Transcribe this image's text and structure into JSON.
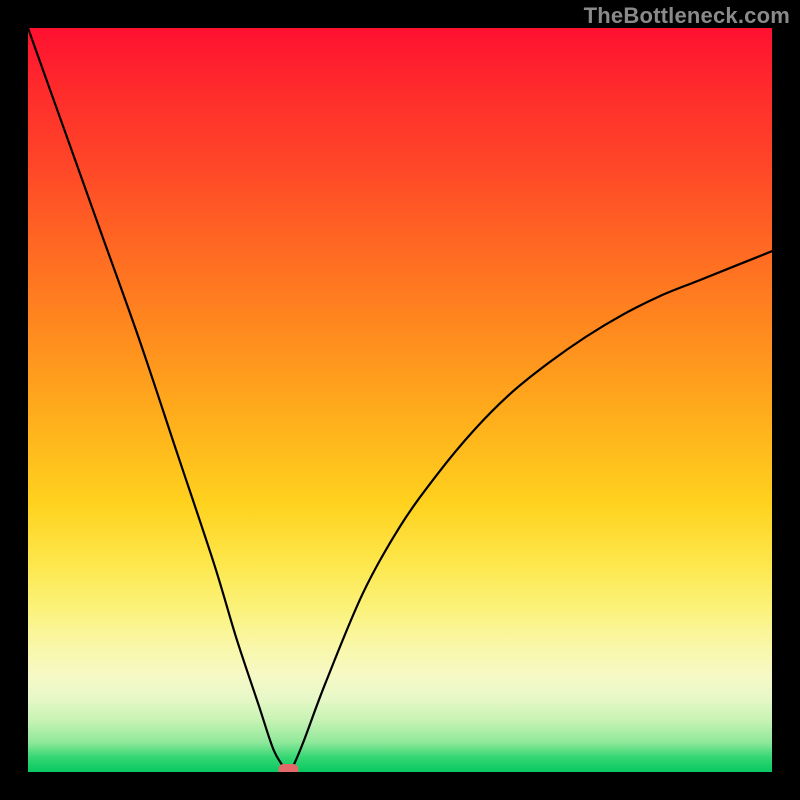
{
  "watermark": {
    "text": "TheBottleneck.com"
  },
  "colors": {
    "frame": "#000000",
    "curve_stroke": "#000000",
    "marker_fill": "#e46a6a",
    "gradient_stops": [
      "#ff1030",
      "#ff2a2c",
      "#ff4528",
      "#ff6a22",
      "#ff8e1e",
      "#ffb31c",
      "#ffd21e",
      "#fde74c",
      "#fbf27a",
      "#f9f7a8",
      "#f6f9c6",
      "#e8f8c8",
      "#c8f3b5",
      "#8fe89a",
      "#35d774",
      "#08c862"
    ]
  },
  "chart_data": {
    "type": "line",
    "title": "",
    "xlabel": "",
    "ylabel": "",
    "xlim": [
      0,
      100
    ],
    "ylim": [
      0,
      100
    ],
    "grid": false,
    "legend": false,
    "description": "V-shaped bottleneck curve on a vertical red→yellow→green gradient. Minimum (optimal / zero-bottleneck point) at roughly x≈35, y≈0. Curve rises steeply to the left and more gradually to the right toward y≈70.",
    "series": [
      {
        "name": "bottleneck-curve",
        "x": [
          0,
          5,
          10,
          15,
          20,
          25,
          28,
          31,
          33,
          34.5,
          35,
          35.5,
          37,
          40,
          45,
          50,
          55,
          60,
          65,
          70,
          75,
          80,
          85,
          90,
          95,
          100
        ],
        "y": [
          100,
          86,
          72,
          58,
          43,
          28,
          18,
          9,
          3,
          0.5,
          0,
          0.5,
          4,
          12,
          24,
          33,
          40,
          46,
          51,
          55,
          58.5,
          61.5,
          64,
          66,
          68,
          70
        ]
      }
    ],
    "marker": {
      "x": 35,
      "y": 0,
      "shape": "rounded-rect"
    }
  }
}
